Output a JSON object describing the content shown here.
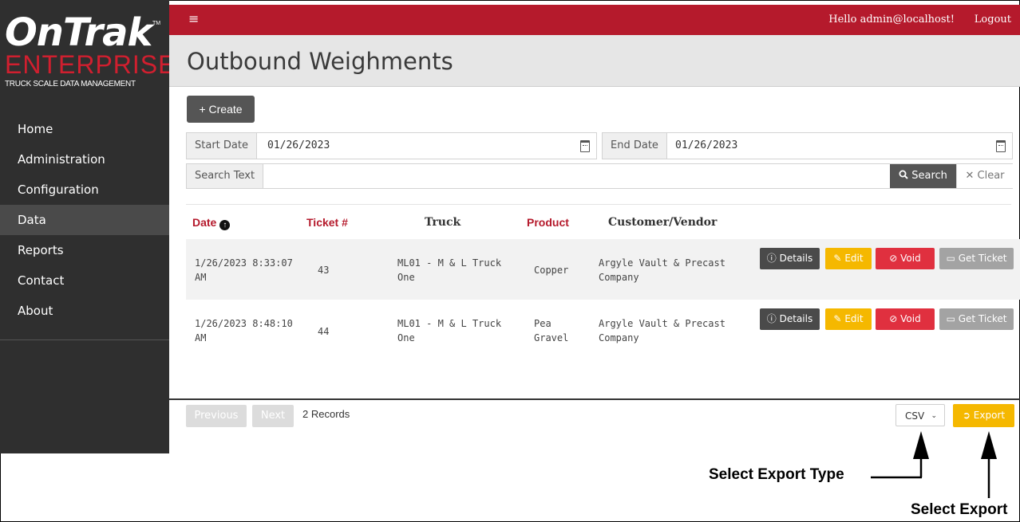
{
  "logo": {
    "brand": "OnTrak",
    "tm": "TM",
    "sub": "ENTERPRISE",
    "tagline": "TRUCK SCALE DATA MANAGEMENT"
  },
  "nav": {
    "items": [
      {
        "label": "Home"
      },
      {
        "label": "Administration"
      },
      {
        "label": "Configuration"
      },
      {
        "label": "Data",
        "active": true
      },
      {
        "label": "Reports"
      },
      {
        "label": "Contact"
      },
      {
        "label": "About"
      }
    ]
  },
  "header": {
    "menu_icon": "hamburger-icon",
    "greeting": "Hello admin@localhost!",
    "logout": "Logout"
  },
  "page": {
    "title": "Outbound Weighments",
    "create_label": "+ Create"
  },
  "filters": {
    "start_label": "Start Date",
    "start_value": "01/26/2023",
    "end_label": "End Date",
    "end_value": "01/26/2023",
    "search_label": "Search Text",
    "search_value": "",
    "search_button": "Search",
    "clear_button": "Clear"
  },
  "table": {
    "headers": {
      "date": "Date",
      "ticket": "Ticket #",
      "truck": "Truck",
      "product": "Product",
      "customer": "Customer/Vendor"
    },
    "rows": [
      {
        "date_l1": "1/26/2023 8:33:07",
        "date_l2": "AM",
        "ticket": "43",
        "truck_l1": "ML01 - M & L Truck",
        "truck_l2": "One",
        "product_l1": "Copper",
        "product_l2": "",
        "cust_l1": "Argyle Vault & Precast",
        "cust_l2": "Company"
      },
      {
        "date_l1": "1/26/2023 8:48:10",
        "date_l2": "AM",
        "ticket": "44",
        "truck_l1": "ML01 - M & L Truck",
        "truck_l2": "One",
        "product_l1": "Pea",
        "product_l2": "Gravel",
        "cust_l1": "Argyle Vault & Precast",
        "cust_l2": "Company"
      }
    ],
    "actions": {
      "details": "Details",
      "edit": "Edit",
      "void": "Void",
      "ticket": "Get Ticket"
    }
  },
  "footer": {
    "previous": "Previous",
    "next": "Next",
    "records": "2 Records",
    "export_type": "CSV",
    "export": "Export"
  },
  "annotations": {
    "select_type": "Select Export Type",
    "select_export": "Select Export"
  },
  "colors": {
    "brand_red": "#b51a2c",
    "sidebar": "#2f2f2f",
    "warning": "#f5b800",
    "danger": "#e0303f"
  }
}
